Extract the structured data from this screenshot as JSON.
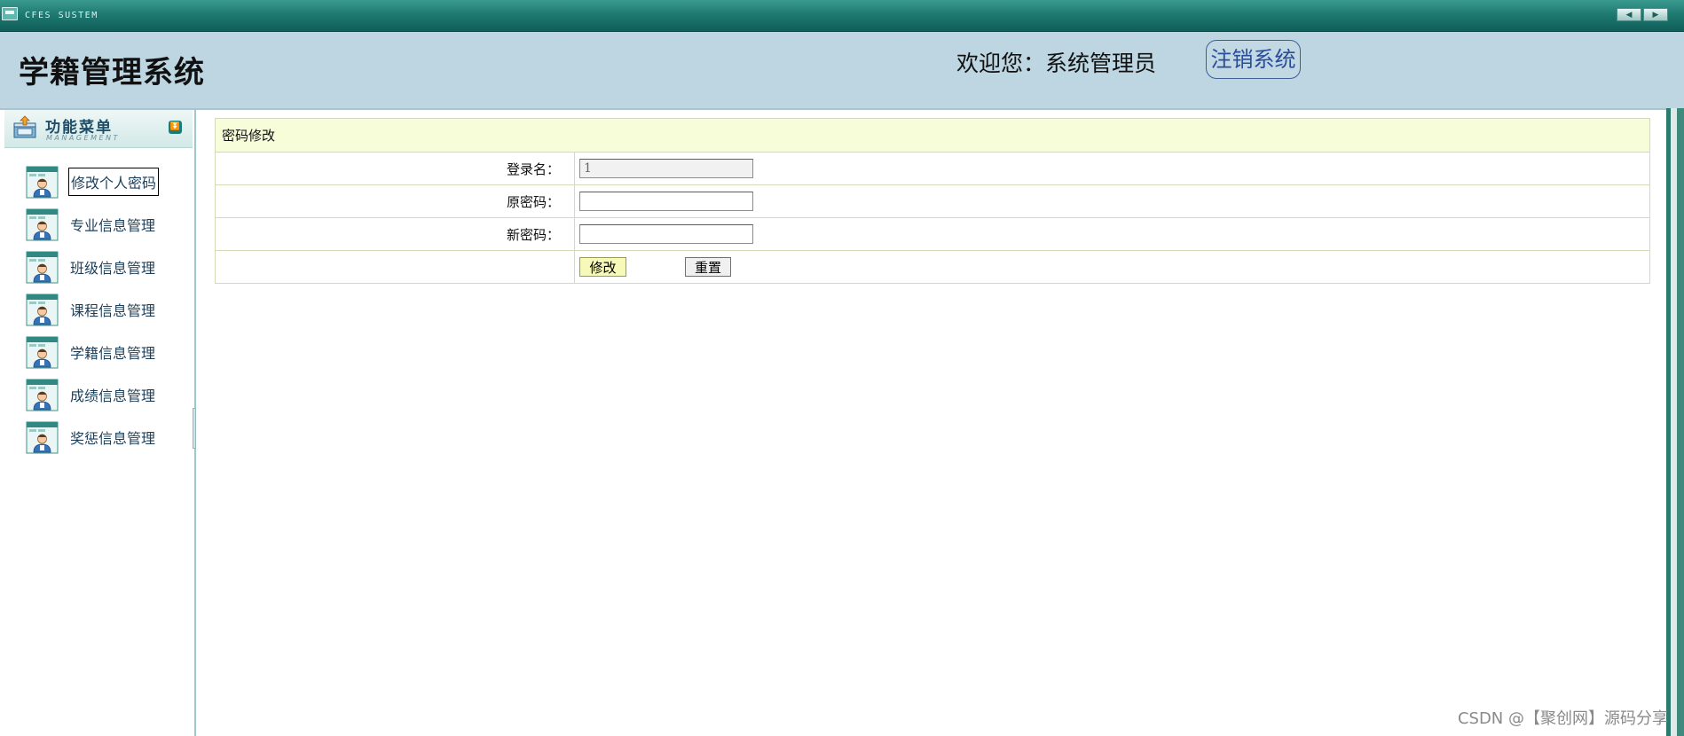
{
  "window": {
    "app_name": "CFES SUSTEM",
    "nav_prev": "◀",
    "nav_next": "▶"
  },
  "header": {
    "title": "学籍管理系统",
    "welcome": "欢迎您：系统管理员",
    "logout_label": "注销系统"
  },
  "sidebar": {
    "title": "功能菜单",
    "subtitle": "MANAGEMENT",
    "collapse_icon": "chevron-double-down",
    "items": [
      {
        "label": "修改个人密码",
        "active": true
      },
      {
        "label": "专业信息管理"
      },
      {
        "label": "班级信息管理"
      },
      {
        "label": "课程信息管理"
      },
      {
        "label": "学籍信息管理"
      },
      {
        "label": "成绩信息管理"
      },
      {
        "label": "奖惩信息管理"
      }
    ]
  },
  "form": {
    "caption": "密码修改",
    "login_label": "登录名：",
    "login_value": "1",
    "old_password_label": "原密码：",
    "old_password_value": "",
    "new_password_label": "新密码：",
    "new_password_value": "",
    "submit_label": "修改",
    "reset_label": "重置"
  },
  "watermark": "CSDN @【聚创网】源码分享",
  "colors": {
    "titlebar": "#1f7a72",
    "header_bg": "#bdd6e1",
    "form_caption_bg": "#f7fcd9",
    "submit_bg": "#f6f9b8",
    "logout_text": "#2a4d9a"
  }
}
